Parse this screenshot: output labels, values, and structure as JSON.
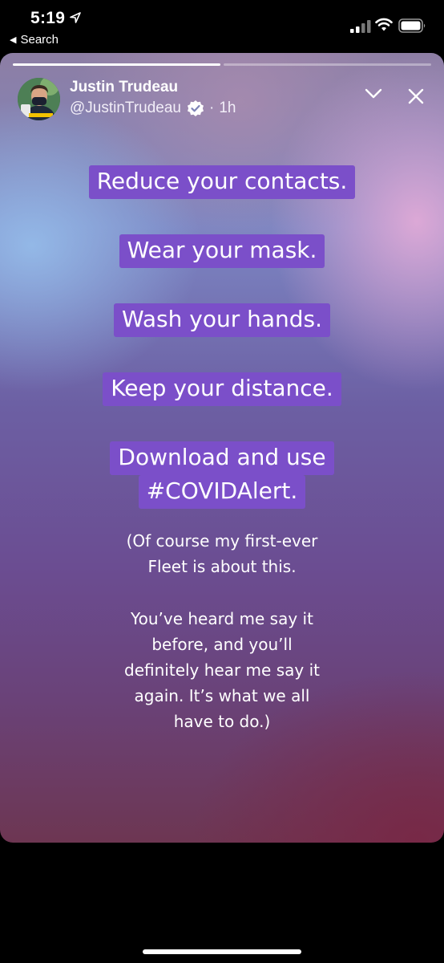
{
  "status_bar": {
    "time": "5:19",
    "back_label": "Search",
    "icons": [
      "location-arrow-icon",
      "signal-icon",
      "wifi-icon",
      "battery-icon"
    ]
  },
  "fleet": {
    "progress": [
      1.0,
      0.0
    ],
    "author": {
      "name": "Justin Trudeau",
      "handle": "@JustinTrudeau",
      "separator": "·",
      "time": "1h"
    },
    "pills": [
      [
        "Reduce your contacts."
      ],
      [
        "Wear your mask."
      ],
      [
        "Wash your hands."
      ],
      [
        "Keep your distance."
      ],
      [
        "Download and use",
        "#COVIDAlert."
      ]
    ],
    "note_paragraphs": [
      [
        "(Of course my first-ever",
        "Fleet is about this."
      ],
      [
        "You’ve heard me say it",
        "before, and you’ll",
        "definitely hear me say it",
        "again. It’s what we all",
        "have to do.)"
      ]
    ]
  },
  "colors": {
    "pill_background": "#7b4fc9",
    "page_background": "#000000"
  }
}
